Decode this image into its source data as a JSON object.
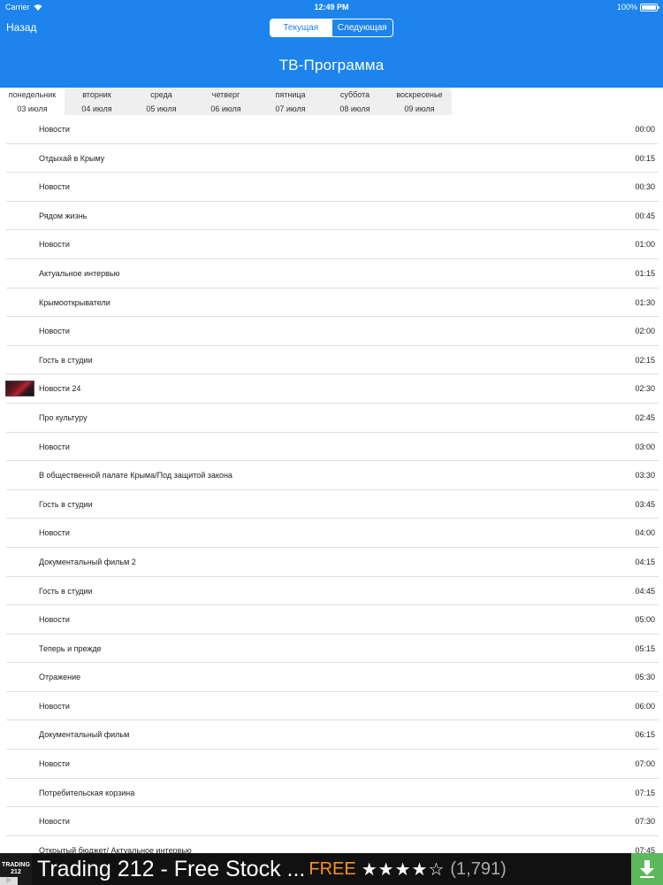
{
  "statusbar": {
    "carrier": "Carrier",
    "time": "12:49 PM",
    "battery": "100%",
    "battery_level": 1.0
  },
  "nav": {
    "back_label": "Назад",
    "segments": [
      {
        "label": "Текущая",
        "active": true
      },
      {
        "label": "Следующая",
        "active": false
      }
    ],
    "title": "ТВ-Программа"
  },
  "days": [
    {
      "weekday": "понедельник",
      "date": "03 июля",
      "selected": true
    },
    {
      "weekday": "вторник",
      "date": "04 июля",
      "selected": false
    },
    {
      "weekday": "среда",
      "date": "05 июля",
      "selected": false
    },
    {
      "weekday": "четверг",
      "date": "06 июля",
      "selected": false
    },
    {
      "weekday": "пятница",
      "date": "07 июля",
      "selected": false
    },
    {
      "weekday": "суббота",
      "date": "08 июля",
      "selected": false
    },
    {
      "weekday": "воскресенье",
      "date": "09 июля",
      "selected": false
    }
  ],
  "programs": [
    {
      "title": "Новости",
      "time": "00:00"
    },
    {
      "title": "Отдыхай в Крыму",
      "time": "00:15"
    },
    {
      "title": "Новости",
      "time": "00:30"
    },
    {
      "title": "Рядом жизнь",
      "time": "00:45"
    },
    {
      "title": "Новости",
      "time": "01:00"
    },
    {
      "title": "Актуальное интервью",
      "time": "01:15"
    },
    {
      "title": "Крымооткрыватели",
      "time": "01:30"
    },
    {
      "title": "Новости",
      "time": "02:00"
    },
    {
      "title": "Гость в студии",
      "time": "02:15"
    },
    {
      "title": "Новости 24",
      "time": "02:30",
      "thumbnail": true
    },
    {
      "title": "Про культуру",
      "time": "02:45"
    },
    {
      "title": "Новости",
      "time": "03:00"
    },
    {
      "title": "В общественной палате Крыма/Под защитой закона",
      "time": "03:30"
    },
    {
      "title": "Гость в студии",
      "time": "03:45"
    },
    {
      "title": "Новости",
      "time": "04:00"
    },
    {
      "title": "Документальный фильм 2",
      "time": "04:15"
    },
    {
      "title": "Гость в студии",
      "time": "04:45"
    },
    {
      "title": "Новости",
      "time": "05:00"
    },
    {
      "title": "Теперь и прежде",
      "time": "05:15"
    },
    {
      "title": "Отражение",
      "time": "05:30"
    },
    {
      "title": "Новости",
      "time": "06:00"
    },
    {
      "title": "Документальный фильм",
      "time": "06:15"
    },
    {
      "title": "Новости",
      "time": "07:00"
    },
    {
      "title": "Потребительская корзина",
      "time": "07:15"
    },
    {
      "title": "Новости",
      "time": "07:30"
    },
    {
      "title": "Открытый бюджет/ Актуальное интервью",
      "time": "07:45"
    }
  ],
  "ad": {
    "logo_line1": "TRADING",
    "logo_line2": "212",
    "text": "Trading 212 - Free Stock ...",
    "price": "FREE",
    "stars": "★★★★☆",
    "rating": 4,
    "rating_count": "(1,791)",
    "accent_color": "#5cb85c"
  },
  "colors": {
    "header": "#1c84ec"
  }
}
